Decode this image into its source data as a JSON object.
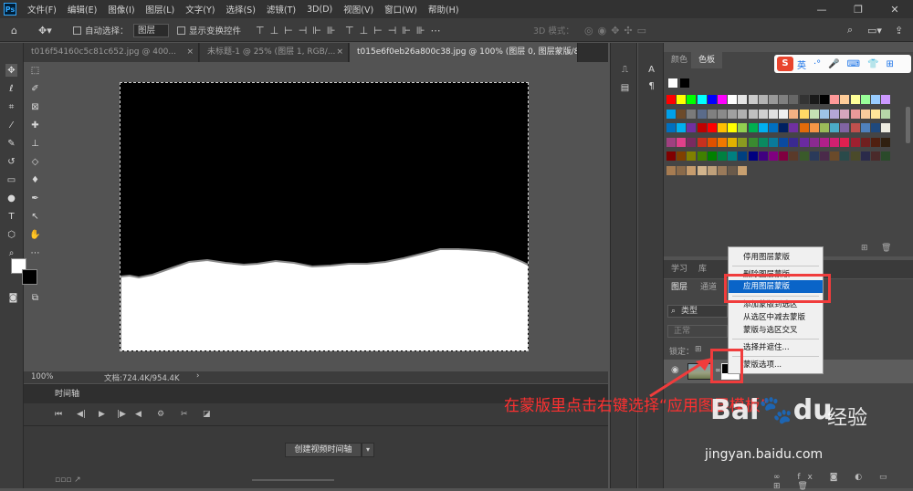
{
  "app": {
    "logo": "Ps"
  },
  "menu": [
    "文件(F)",
    "编辑(E)",
    "图像(I)",
    "图层(L)",
    "文字(Y)",
    "选择(S)",
    "滤镜(T)",
    "3D(D)",
    "视图(V)",
    "窗口(W)",
    "帮助(H)"
  ],
  "window_controls": {
    "minimize": "—",
    "restore": "❐",
    "close": "✕"
  },
  "options": {
    "auto_select_label": "自动选择：",
    "auto_select_value": "图层",
    "transform_label": "显示变换控件",
    "mode_3d_label": "3D 模式："
  },
  "tabs": [
    {
      "label": "t016f54160c5c81c652.jpg @ 400...",
      "close": "×"
    },
    {
      "label": "未标题-1 @ 25% (图层 1, RGB/...",
      "close": "×"
    },
    {
      "label": "t015e6f0eb26a800c38.jpg @ 100% (图层 0, 图层蒙版/8) *",
      "close": "×"
    }
  ],
  "status": {
    "zoom": "100%",
    "doc": "文档:724.4K/954.4K",
    "arrow": "›"
  },
  "timeline": {
    "title": "时间轴",
    "create_button": "创建视频时间轴",
    "dropdown_arrow": "▾"
  },
  "right_strip": {
    "text_icon": "A",
    "para_icon": "¶"
  },
  "swatch_panel": {
    "tabs": [
      "颜色",
      "色板"
    ]
  },
  "learn_panel": {
    "tabs": [
      "学习",
      "库"
    ]
  },
  "layers_panel": {
    "tabs": [
      "图层",
      "通道"
    ],
    "filter_label": "类型",
    "blend_mode": "正常",
    "lock_label": "锁定："
  },
  "context_menu": {
    "items": [
      "停用图层蒙版",
      "删除图层蒙版",
      "应用图层蒙版",
      "添加蒙版到选区",
      "从选区中减去蒙版",
      "蒙版与选区交叉",
      "选择并遮住...",
      "蒙版选项..."
    ],
    "highlighted_index": 2
  },
  "annotation": {
    "text": "在蒙版里点击右键选择“应用图层模板”"
  },
  "ime": {
    "logo": "S",
    "mode": "英",
    "symbols": "·°",
    "icons": [
      "mic-icon",
      "keyboard-icon",
      "shirt-icon",
      "grid-icon"
    ]
  },
  "watermark": {
    "brand": "Bai",
    "brand2": "du",
    "cn": "经验",
    "url": "jingyan.baidu.com"
  },
  "colors": {
    "accent": "#0a64c8",
    "annotation_red": "#f03c3c"
  }
}
